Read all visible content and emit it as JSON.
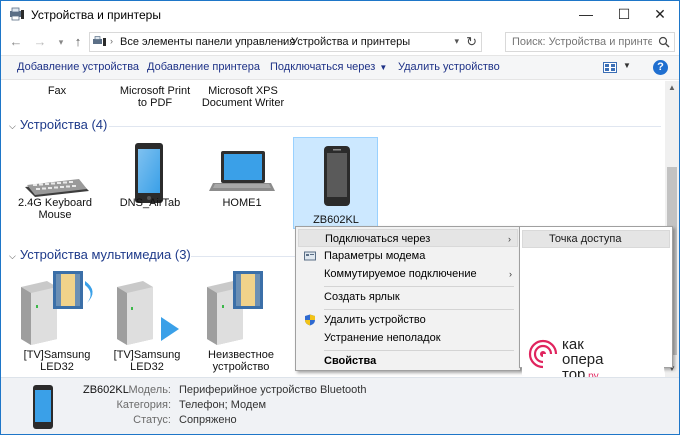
{
  "window": {
    "title": "Устройства и принтеры",
    "minimize": "—",
    "maximize": "☐",
    "close": "✕"
  },
  "address": {
    "crumbs": [
      "Все элементы панели управления",
      "Устройства и принтеры"
    ],
    "search_placeholder": "Поиск: Устройства и принте..."
  },
  "toolbar": {
    "add_device": "Добавление устройства",
    "add_printer": "Добавление принтера",
    "connect_via": "Подключаться через",
    "remove_device": "Удалить устройство"
  },
  "top_items": [
    {
      "line1": "Fax",
      "line2": ""
    },
    {
      "line1": "Microsoft Print",
      "line2": "to PDF"
    },
    {
      "line1": "Microsoft XPS",
      "line2": "Document Writer"
    }
  ],
  "groups": {
    "devices": "Устройства (4)",
    "multimedia": "Устройства мультимедиа (3)"
  },
  "devices": [
    {
      "line1": "2.4G Keyboard",
      "line2": "Mouse"
    },
    {
      "line1": "DNS_AirTab",
      "line2": ""
    },
    {
      "line1": "HOME1",
      "line2": ""
    },
    {
      "line1": "ZB602KL",
      "line2": ""
    }
  ],
  "multimedia": [
    {
      "line1": "[TV]Samsung",
      "line2": "LED32"
    },
    {
      "line1": "[TV]Samsung",
      "line2": "LED32"
    },
    {
      "line1": "Неизвестное",
      "line2": "устройство"
    }
  ],
  "context_menu": {
    "items": [
      {
        "label": "Подключаться через",
        "submenu": true
      },
      {
        "label": "Параметры модема"
      },
      {
        "label": "Коммутируемое подключение",
        "submenu": true
      },
      {
        "label": "Создать ярлык"
      },
      {
        "label": "Удалить устройство"
      },
      {
        "label": "Устранение неполадок"
      },
      {
        "label": "Свойства"
      }
    ],
    "submenu_item": "Точка доступа"
  },
  "watermark": {
    "line1": "как",
    "line2": "опера",
    "line3": "тор",
    "suffix": ".ру"
  },
  "details": {
    "name": "ZB602KL",
    "model_key": "Модель:",
    "model_val": "Периферийное устройство Bluetooth",
    "category_key": "Категория:",
    "category_val": "Телефон; Модем",
    "status_key": "Статус:",
    "status_val": "Сопряжено"
  },
  "colors": {
    "accent": "#1e76c8",
    "link": "#1e3287",
    "selection": "#cce8ff",
    "brand": "#e0245e"
  }
}
